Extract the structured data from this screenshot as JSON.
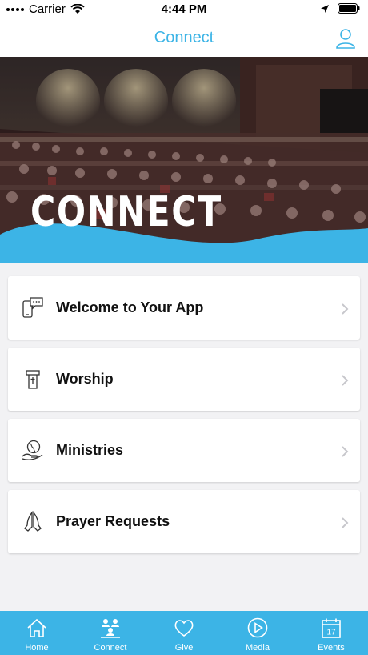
{
  "status_bar": {
    "carrier": "Carrier",
    "time": "4:44 PM"
  },
  "nav": {
    "title": "Connect",
    "profile_icon": "user-icon"
  },
  "hero": {
    "title": "CONNECT",
    "wave_color": "#3cb4e6"
  },
  "list": [
    {
      "label": "Welcome to Your App",
      "icon": "phone-chat-icon"
    },
    {
      "label": "Worship",
      "icon": "pulpit-icon"
    },
    {
      "label": "Ministries",
      "icon": "globe-hand-icon"
    },
    {
      "label": "Prayer Requests",
      "icon": "praying-hands-icon"
    }
  ],
  "tabs": [
    {
      "label": "Home",
      "icon": "home-icon"
    },
    {
      "label": "Connect",
      "icon": "people-icon"
    },
    {
      "label": "Give",
      "icon": "heart-icon"
    },
    {
      "label": "Media",
      "icon": "play-icon"
    },
    {
      "label": "Events",
      "icon": "calendar-icon",
      "badge_text": "17"
    }
  ],
  "colors": {
    "accent": "#3cb4e6",
    "background": "#f2f2f4",
    "text": "#111111"
  }
}
